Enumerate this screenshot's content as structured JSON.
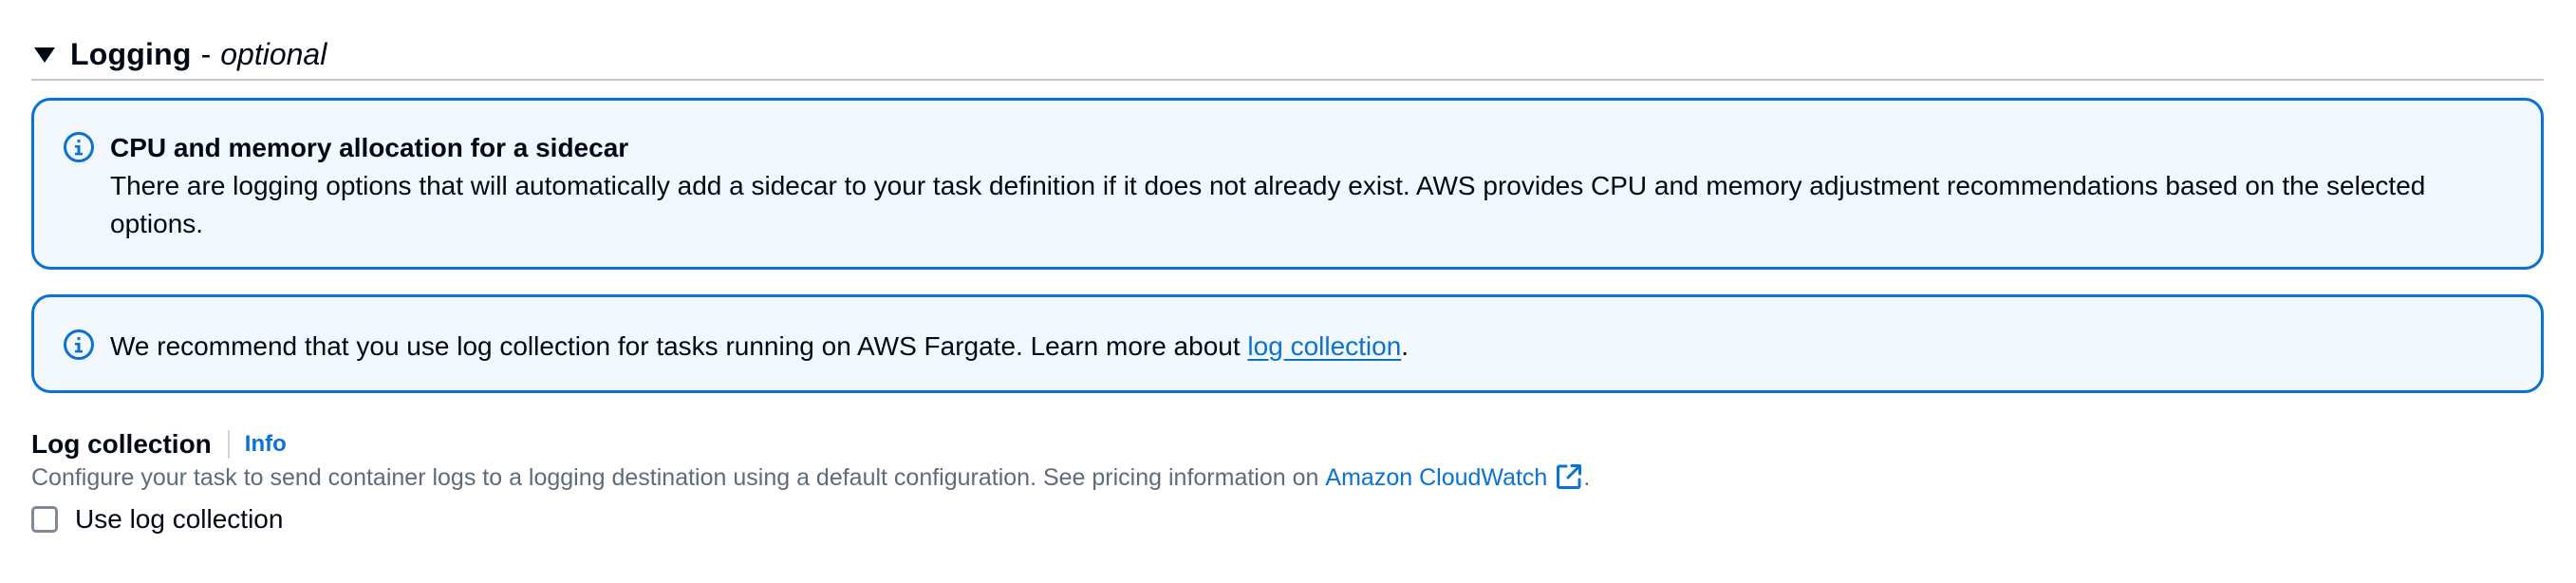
{
  "section": {
    "title": "Logging",
    "separator": "-",
    "optional": "optional"
  },
  "alerts": [
    {
      "icon": "info-circle-icon",
      "heading": "CPU and memory allocation for a sidecar",
      "text": "There are logging options that will automatically add a sidecar to your task definition if it does not already exist. AWS provides CPU and memory adjustment recommendations based on the selected options."
    },
    {
      "icon": "info-circle-icon",
      "text_before": "We recommend that you use log collection for tasks running on AWS Fargate. Learn more about ",
      "link": "log collection",
      "text_after": "."
    }
  ],
  "log_collection": {
    "label": "Log collection",
    "info_link": "Info",
    "description": "Configure your task to send container logs to a logging destination using a default configuration. See pricing information on",
    "description_link": "Amazon CloudWatch",
    "description_end": ".",
    "checkbox_label": "Use log collection",
    "checkbox_checked": false
  },
  "colors": {
    "accent": "#0972d3",
    "alert_background": "#f2f8fd",
    "text": "#000716",
    "secondary_text": "#5f6b7a"
  }
}
